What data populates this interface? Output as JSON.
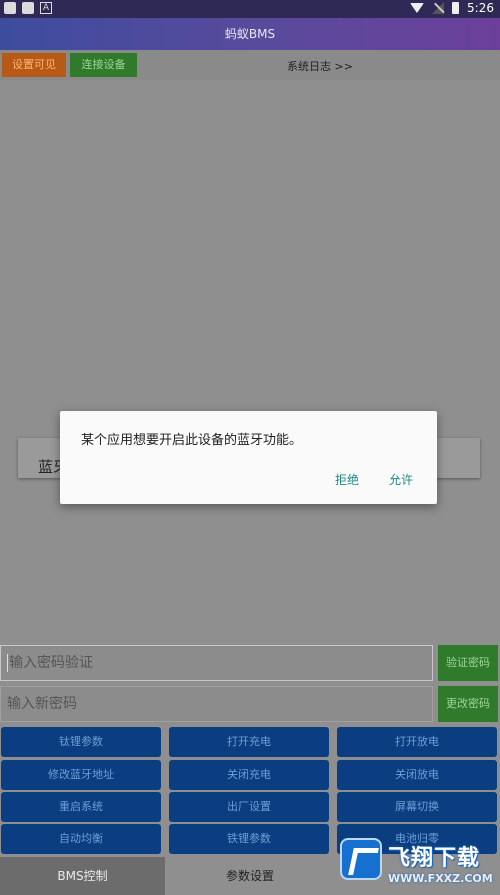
{
  "status_bar": {
    "time": "5:26",
    "left_icons": [
      "notification-square-icon",
      "notification-square-icon",
      "a-notification-icon"
    ],
    "right_icons": [
      "wifi-icon",
      "no-signal-icon",
      "battery-icon"
    ]
  },
  "app": {
    "title": "蚂蚁BMS"
  },
  "toolbar": {
    "visible_label": "设置可见",
    "connect_label": "连接设备",
    "log_label": "系统日志 >>"
  },
  "background_card": {
    "text": "蓝牙"
  },
  "dialog": {
    "message": "某个应用想要开启此设备的蓝牙功能。",
    "deny_label": "拒绝",
    "allow_label": "允许"
  },
  "password": {
    "verify_placeholder": "输入密码验证",
    "verify_button": "验证密码",
    "new_placeholder": "输入新密码",
    "change_button": "更改密码"
  },
  "buttons": {
    "row1": [
      "钛锂参数",
      "打开充电",
      "打开放电"
    ],
    "row2": [
      "修改蓝牙地址",
      "关闭充电",
      "关闭放电"
    ],
    "row3": [
      "重启系统",
      "出厂设置",
      "屏幕切换"
    ],
    "row4": [
      "自动均衡",
      "铁锂参数",
      "电池归零"
    ]
  },
  "tabs": {
    "bms": "BMS控制",
    "params": "参数设置"
  },
  "watermark": {
    "title": "飞翔下载",
    "url": "WWW.FXXZ.COM"
  },
  "colors": {
    "accent_green": "#2f7a2b",
    "accent_orange": "#b85a17",
    "button_blue": "#0b3e80",
    "dialog_button": "#1b8a80"
  }
}
